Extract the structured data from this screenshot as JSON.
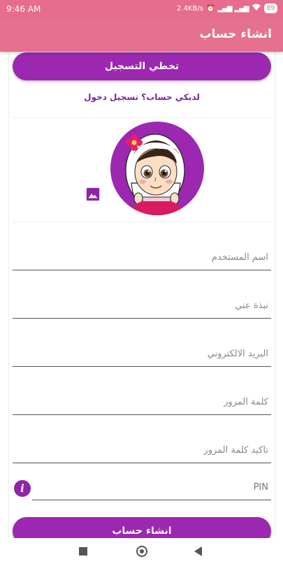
{
  "status_bar": {
    "time": "9:46 AM",
    "network_speed": "2.4KB/s",
    "battery": "89"
  },
  "app_bar": {
    "title": "انشاء حساب"
  },
  "form": {
    "skip_label": "تخطي التسجيل",
    "login_link": "لديكي حساب؟ تسجيل دخول",
    "fields": {
      "username": "اسم المستخدم",
      "bio": "نبذة عني",
      "email": "البريد الالكتروني",
      "password": "كلمة المرور",
      "confirm_password": "تاكيد كلمة المرور",
      "pin": "PIN"
    },
    "create_label": "انشاء حساب"
  },
  "colors": {
    "accent": "#9c27b0",
    "app_bar": "#e5708f",
    "status_bar": "#e76c8d"
  },
  "icons": {
    "avatar": "girl-in-hijab-avatar",
    "image_picker": "image-icon",
    "info": "info-icon"
  }
}
